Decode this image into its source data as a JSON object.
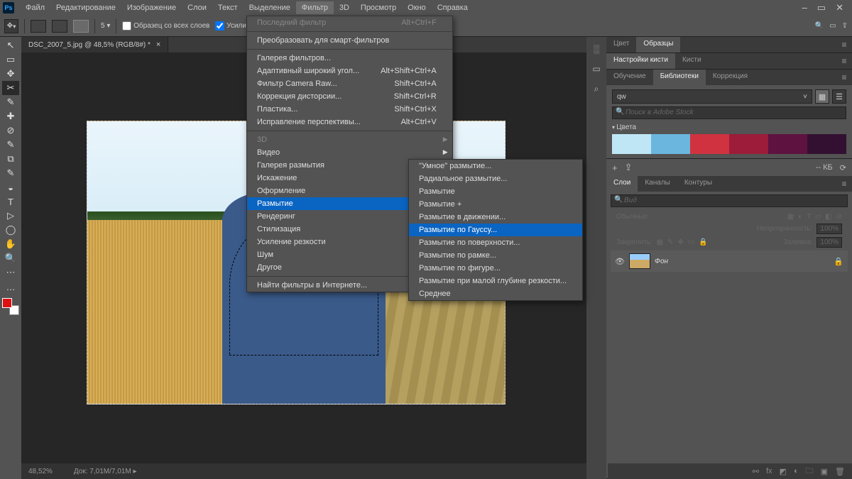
{
  "menubar": [
    "Файл",
    "Редактирование",
    "Изображение",
    "Слои",
    "Текст",
    "Выделение",
    "Фильтр",
    "3D",
    "Просмотр",
    "Окно",
    "Справка"
  ],
  "active_menu_index": 6,
  "optbar": {
    "sample_label": "Образец со всех слоев",
    "enhance_label": "Усилить автомат"
  },
  "doctab": {
    "title": "DSC_2007_5.jpg @ 48,5% (RGB/8#) *"
  },
  "status": {
    "zoom": "48,52%",
    "doc": "Док: 7,01M/7,01M"
  },
  "panels": {
    "color_tabs": [
      "Цвет",
      "Образцы"
    ],
    "brush_tabs": [
      "Настройки кисти",
      "Кисти"
    ],
    "lib_tabs": [
      "Обучение",
      "Библиотеки",
      "Коррекция"
    ],
    "lib_select": "qw",
    "lib_search_ph": "Поиск в Adobe Stock",
    "lib_section": "Цвета",
    "swatches": [
      "#bfe6f5",
      "#6bb6df",
      "#d0333f",
      "#9c1c3a",
      "#5e1240",
      "#331031"
    ],
    "kb_label": "-- КБ",
    "layer_tabs": [
      "Слои",
      "Каналы",
      "Контуры"
    ],
    "layer_search_ph": "Вид",
    "blend_label": "Обычные",
    "opacity_label": "Непрозрачность:",
    "opacity_val": "100%",
    "lock_label": "Закрепить:",
    "fill_label": "Заливка:",
    "fill_val": "100%",
    "layer_name": "Фон"
  },
  "filter_menu": [
    {
      "label": "Последний фильтр",
      "shortcut": "Alt+Ctrl+F",
      "disabled": true
    },
    {
      "sep": true
    },
    {
      "label": "Преобразовать для смарт-фильтров"
    },
    {
      "sep": true
    },
    {
      "label": "Галерея фильтров..."
    },
    {
      "label": "Адаптивный широкий угол...",
      "shortcut": "Alt+Shift+Ctrl+A"
    },
    {
      "label": "Фильтр Camera Raw...",
      "shortcut": "Shift+Ctrl+A"
    },
    {
      "label": "Коррекция дисторсии...",
      "shortcut": "Shift+Ctrl+R"
    },
    {
      "label": "Пластика...",
      "shortcut": "Shift+Ctrl+X"
    },
    {
      "label": "Исправление перспективы...",
      "shortcut": "Alt+Ctrl+V"
    },
    {
      "sep": true
    },
    {
      "label": "3D",
      "sub": true,
      "disabled": true
    },
    {
      "label": "Видео",
      "sub": true
    },
    {
      "label": "Галерея размытия",
      "sub": true
    },
    {
      "label": "Искажение",
      "sub": true
    },
    {
      "label": "Оформление",
      "sub": true
    },
    {
      "label": "Размытие",
      "sub": true,
      "hl": true
    },
    {
      "label": "Рендеринг",
      "sub": true
    },
    {
      "label": "Стилизация",
      "sub": true
    },
    {
      "label": "Усиление резкости",
      "sub": true
    },
    {
      "label": "Шум",
      "sub": true
    },
    {
      "label": "Другое",
      "sub": true
    },
    {
      "sep": true
    },
    {
      "label": "Найти фильтры в Интернете..."
    }
  ],
  "blur_menu": [
    {
      "label": "\"Умное\" размытие..."
    },
    {
      "label": "Радиальное размытие..."
    },
    {
      "label": "Размытие"
    },
    {
      "label": "Размытие +"
    },
    {
      "label": "Размытие в движении..."
    },
    {
      "label": "Размытие по Гауссу...",
      "hl": true
    },
    {
      "label": "Размытие по поверхности..."
    },
    {
      "label": "Размытие по рамке..."
    },
    {
      "label": "Размытие по фигуре..."
    },
    {
      "label": "Размытие при малой глубине резкости..."
    },
    {
      "label": "Среднее"
    }
  ],
  "tools": [
    "↖",
    "▭",
    "✥",
    "✂",
    "✎",
    "✚",
    "⊘",
    "✎",
    "⧉",
    "✎",
    "◒",
    "T",
    "▷",
    "◯",
    "✋",
    "🔍",
    "⋯",
    "…"
  ]
}
